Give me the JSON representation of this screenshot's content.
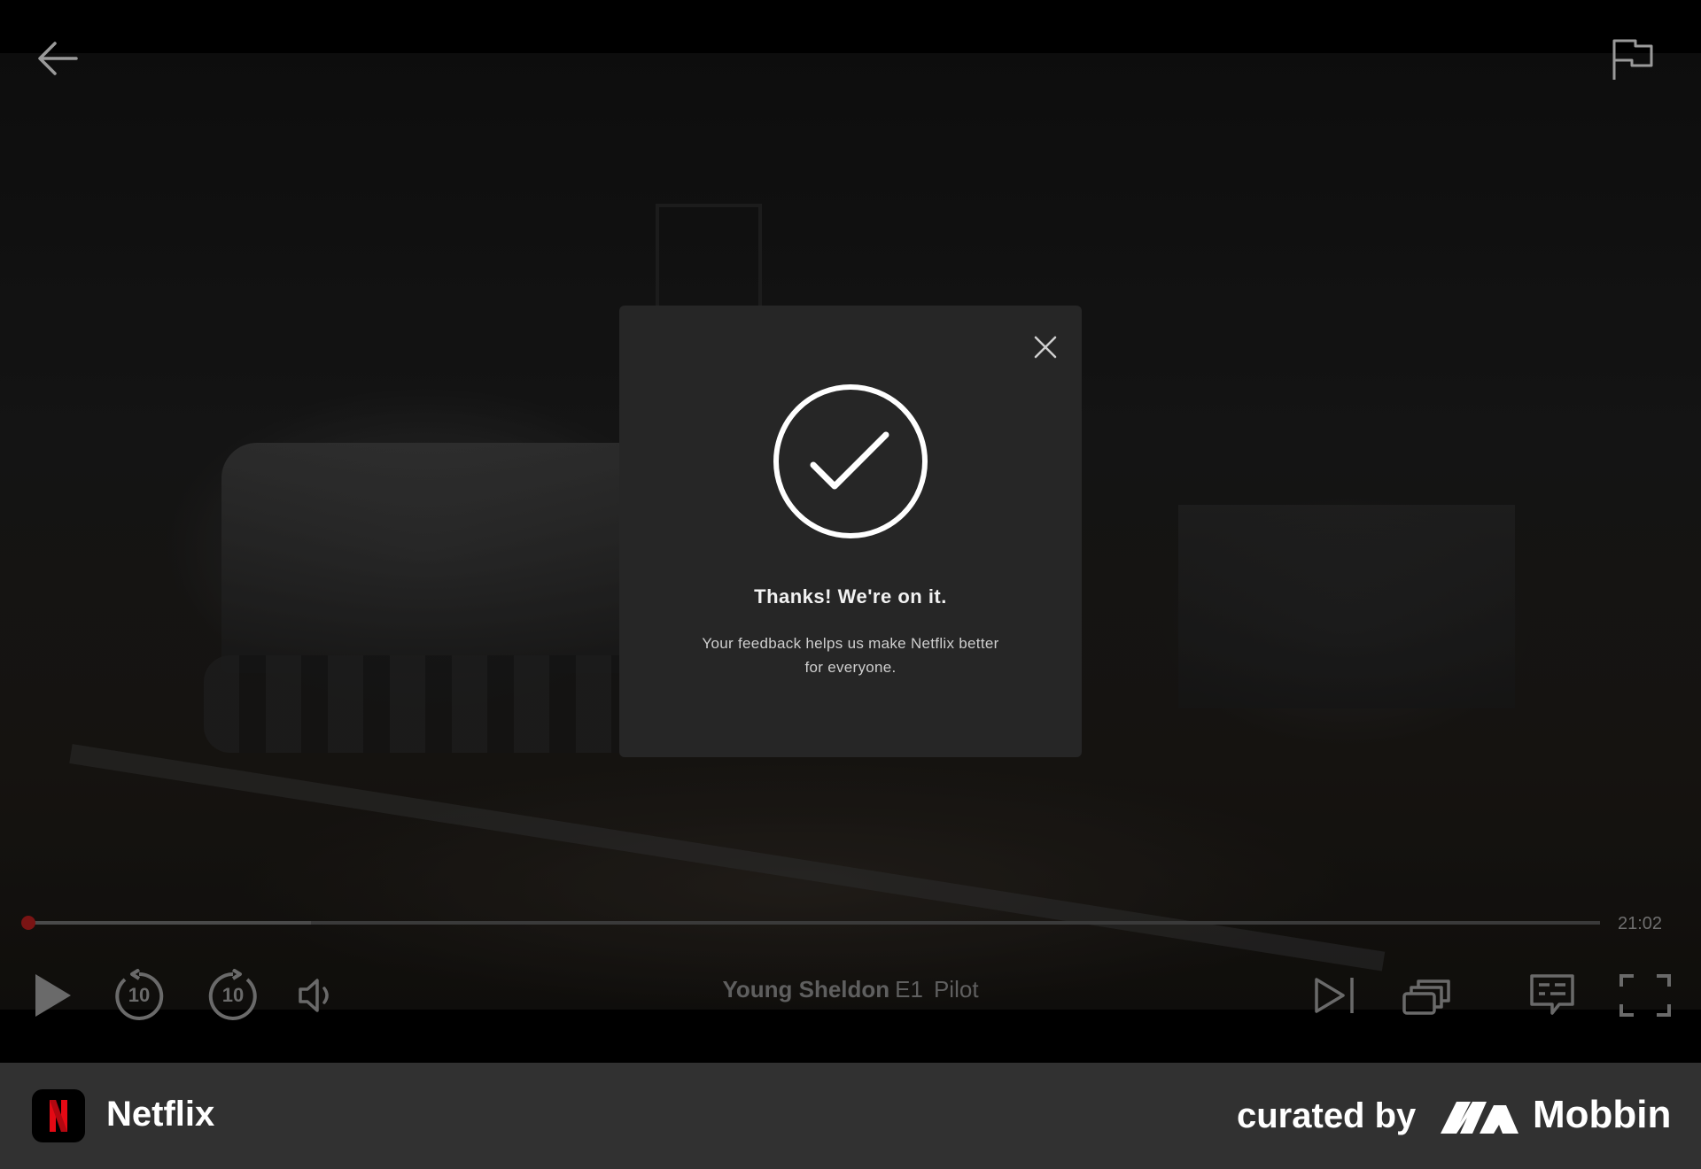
{
  "player": {
    "back_icon": "arrow-left-icon",
    "report_icon": "flag-icon",
    "progress": {
      "fraction": 0.0,
      "buffered_fraction": 0.18
    },
    "time_remaining": "21:02",
    "controls": {
      "play_icon": "play-icon",
      "rewind_label": "10",
      "forward_label": "10",
      "volume_icon": "volume-icon",
      "next_episode_icon": "next-episode-icon",
      "episodes_icon": "episodes-icon",
      "subtitles_icon": "subtitles-icon",
      "fullscreen_icon": "fullscreen-icon"
    },
    "now_playing": {
      "show": "Young Sheldon",
      "episode": "E1",
      "episode_title": "Pilot"
    }
  },
  "modal": {
    "close_icon": "close-icon",
    "check_icon": "check-circle-icon",
    "title": "Thanks! We're on it.",
    "message": "Your feedback helps us make Netflix better for everyone."
  },
  "footer": {
    "app_name": "Netflix",
    "curated_label": "curated by",
    "brand": "Mobbin"
  },
  "colors": {
    "netflix_red": "#E50914",
    "modal_bg": "#262626",
    "footer_bg": "#313131"
  }
}
